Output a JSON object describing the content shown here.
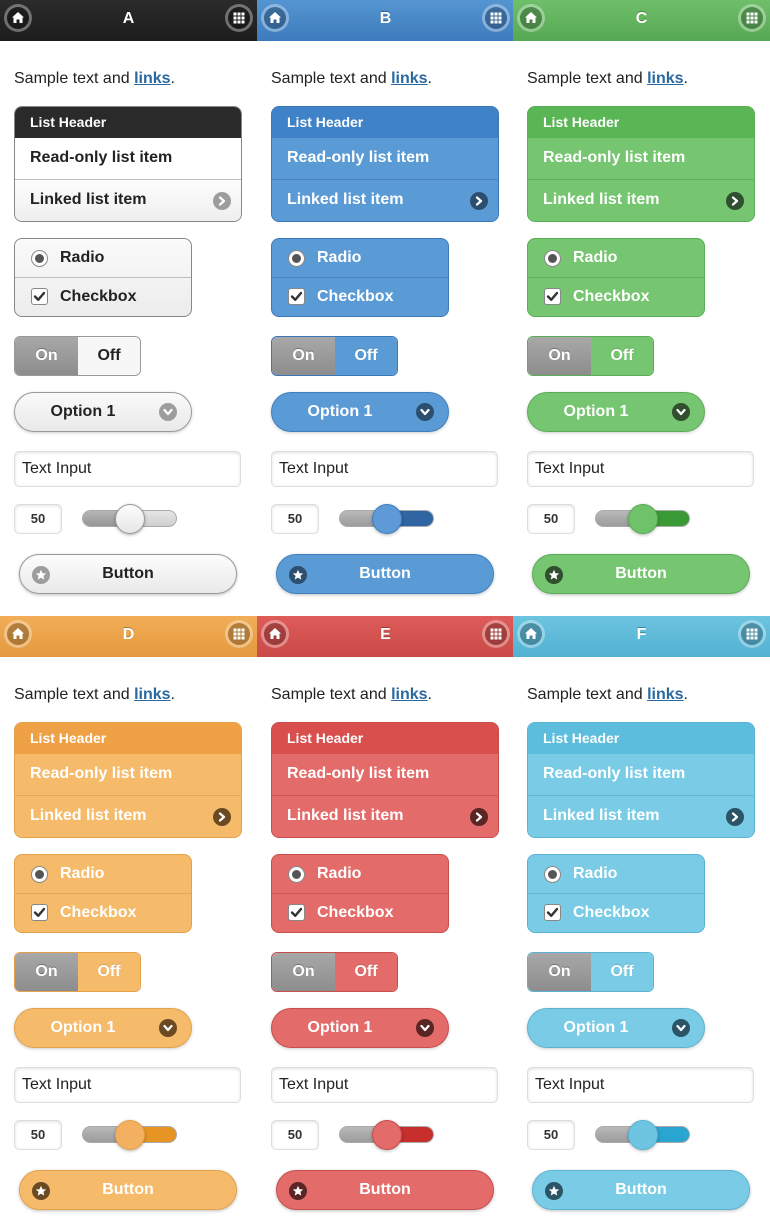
{
  "common": {
    "sample_text": "Sample text and ",
    "link_text": "links",
    "period": ".",
    "list_header": "List Header",
    "readonly_item": "Read-only list item",
    "linked_item": "Linked list item",
    "radio_label": "Radio",
    "checkbox_label": "Checkbox",
    "toggle_on": "On",
    "toggle_off": "Off",
    "select_value": "Option 1",
    "text_input_value": "Text Input",
    "number_value": "50",
    "slider_value_fraction": 0.5,
    "button_label": "Button",
    "icons": {
      "home": "home-icon",
      "grid": "grid-icon",
      "arrow": "arrow-right-icon",
      "chevron": "chevron-down-icon",
      "radio": "radio-selected-icon",
      "checkbox": "checkbox-checked-icon",
      "star": "star-icon"
    }
  },
  "themes": [
    {
      "id": "a",
      "letter": "A",
      "bar": "#2b2b2b",
      "bar_bottom": "#1d1d1d",
      "list_header_bg": "#2a2a2a",
      "list_border": "#888888",
      "item_bg": "#f4f4f4",
      "item_text": "#222222",
      "item_divider": "#bdbdbd",
      "accent": "#ffffff",
      "select_bg": "#f2f2f2",
      "select_text": "#222222",
      "select_border": "#999999",
      "icon_bg": "#9d9d9d",
      "icon_fg": "#ffffff",
      "toggle_off_bg": "#f7f7f7",
      "toggle_off_text": "#222222",
      "slider_fill": "#a0a0a0",
      "thumb": "#f5f5f5"
    },
    {
      "id": "b",
      "letter": "B",
      "bar": "#5595d1",
      "bar_bottom": "#3d7bbd",
      "list_header_bg": "#3f82c8",
      "list_border": "#3a78b8",
      "item_bg": "#5b9bd5",
      "item_text": "#ffffff",
      "item_divider": "#4885c2",
      "accent": "#ffffff",
      "select_bg": "#5b9bd5",
      "select_text": "#ffffff",
      "select_border": "#3f7fbf",
      "icon_bg": "#2d4f6f",
      "icon_fg": "#ffffff",
      "toggle_off_bg": "#5b9bd5",
      "toggle_off_text": "#ffffff",
      "slider_fill": "#2f65a3",
      "thumb": "#5e9ad6"
    },
    {
      "id": "c",
      "letter": "C",
      "bar": "#6fbf6a",
      "bar_bottom": "#57a853",
      "list_header_bg": "#5ab555",
      "list_border": "#5aad55",
      "item_bg": "#76c570",
      "item_text": "#ffffff",
      "item_divider": "#62b15c",
      "accent": "#ffffff",
      "select_bg": "#76c570",
      "select_text": "#ffffff",
      "select_border": "#5aad55",
      "icon_bg": "#2f4f2f",
      "icon_fg": "#ffffff",
      "toggle_off_bg": "#76c570",
      "toggle_off_text": "#ffffff",
      "slider_fill": "#3a9a36",
      "thumb": "#6fc26a"
    },
    {
      "id": "d",
      "letter": "D",
      "bar": "#f2ad56",
      "bar_bottom": "#e39a3f",
      "list_header_bg": "#eea245",
      "list_border": "#e5a14a",
      "item_bg": "#f5bb6b",
      "item_text": "#ffffff",
      "item_divider": "#e7a555",
      "accent": "#ffffff",
      "select_bg": "#f5bb6b",
      "select_text": "#ffffff",
      "select_border": "#e5a14a",
      "icon_bg": "#6b4a23",
      "icon_fg": "#ffffff",
      "toggle_off_bg": "#f5bb6b",
      "toggle_off_text": "#ffffff",
      "slider_fill": "#e69524",
      "thumb": "#f2b060"
    },
    {
      "id": "e",
      "letter": "E",
      "bar": "#de5c5a",
      "bar_bottom": "#c94a48",
      "list_header_bg": "#d84f4d",
      "list_border": "#c84d4b",
      "item_bg": "#e36b69",
      "item_text": "#ffffff",
      "item_divider": "#cf5755",
      "accent": "#ffffff",
      "select_bg": "#e36b69",
      "select_text": "#ffffff",
      "select_border": "#c84d4b",
      "icon_bg": "#5a2524",
      "icon_fg": "#ffffff",
      "toggle_off_bg": "#e36b69",
      "toggle_off_text": "#ffffff",
      "slider_fill": "#c62f2c",
      "thumb": "#e36b69"
    },
    {
      "id": "f",
      "letter": "F",
      "bar": "#6cc4e0",
      "bar_bottom": "#52b1d2",
      "list_header_bg": "#5dbddc",
      "list_border": "#5bb3d3",
      "item_bg": "#7acce6",
      "item_text": "#ffffff",
      "item_divider": "#64b8d6",
      "accent": "#ffffff",
      "select_bg": "#7acce6",
      "select_text": "#ffffff",
      "select_border": "#5bb3d3",
      "icon_bg": "#2b5566",
      "icon_fg": "#ffffff",
      "toggle_off_bg": "#7acce6",
      "toggle_off_text": "#ffffff",
      "slider_fill": "#2aa4d0",
      "thumb": "#6dc5e2"
    }
  ]
}
